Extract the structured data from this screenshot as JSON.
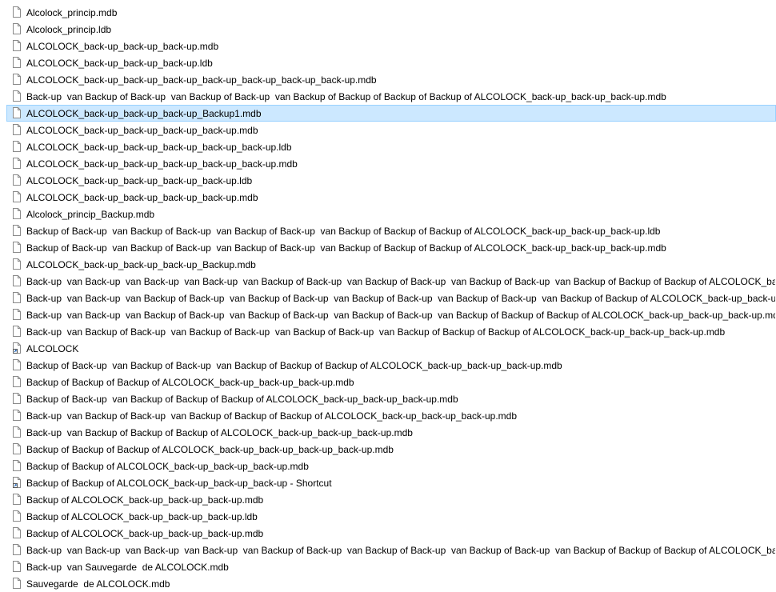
{
  "colors": {
    "selection_bg": "#cce8ff",
    "selection_border": "#99d1ff",
    "icon_stroke": "#8a8a8a",
    "text": "#000000"
  },
  "files": [
    {
      "name": "Alcolock_princip.mdb",
      "icon": "document-icon",
      "selected": false
    },
    {
      "name": "Alcolock_princip.ldb",
      "icon": "document-icon",
      "selected": false
    },
    {
      "name": "ALCOLOCK_back-up_back-up_back-up.mdb",
      "icon": "document-icon",
      "selected": false
    },
    {
      "name": "ALCOLOCK_back-up_back-up_back-up.ldb",
      "icon": "document-icon",
      "selected": false
    },
    {
      "name": "ALCOLOCK_back-up_back-up_back-up_back-up_back-up_back-up_back-up.mdb",
      "icon": "document-icon",
      "selected": false
    },
    {
      "name": "Back-up  van Backup of Back-up  van Backup of Back-up  van Backup of Backup of Backup of Backup of ALCOLOCK_back-up_back-up_back-up.mdb",
      "icon": "document-icon",
      "selected": false
    },
    {
      "name": "ALCOLOCK_back-up_back-up_back-up_Backup1.mdb",
      "icon": "document-icon",
      "selected": true
    },
    {
      "name": "ALCOLOCK_back-up_back-up_back-up_back-up.mdb",
      "icon": "document-icon",
      "selected": false
    },
    {
      "name": "ALCOLOCK_back-up_back-up_back-up_back-up_back-up.ldb",
      "icon": "document-icon",
      "selected": false
    },
    {
      "name": "ALCOLOCK_back-up_back-up_back-up_back-up_back-up.mdb",
      "icon": "document-icon",
      "selected": false
    },
    {
      "name": "ALCOLOCK_back-up_back-up_back-up_back-up.ldb",
      "icon": "document-icon",
      "selected": false
    },
    {
      "name": "ALCOLOCK_back-up_back-up_back-up_back-up.mdb",
      "icon": "document-icon",
      "selected": false
    },
    {
      "name": "Alcolock_princip_Backup.mdb",
      "icon": "document-icon",
      "selected": false
    },
    {
      "name": "Backup of Back-up  van Backup of Back-up  van Backup of Back-up  van Backup of Backup of Backup of ALCOLOCK_back-up_back-up_back-up.ldb",
      "icon": "document-icon",
      "selected": false
    },
    {
      "name": "Backup of Back-up  van Backup of Back-up  van Backup of Back-up  van Backup of Backup of Backup of ALCOLOCK_back-up_back-up_back-up.mdb",
      "icon": "document-icon",
      "selected": false
    },
    {
      "name": "ALCOLOCK_back-up_back-up_back-up_Backup.mdb",
      "icon": "document-icon",
      "selected": false
    },
    {
      "name": "Back-up  van Back-up  van Back-up  van Back-up  van Backup of Back-up  van Backup of Back-up  van Backup of Back-up  van Backup of Backup of Backup of ALCOLOCK_back-up_back-up_back-up.mdb",
      "icon": "document-icon",
      "selected": false
    },
    {
      "name": "Back-up  van Back-up  van Backup of Back-up  van Backup of Back-up  van Backup of Back-up  van Backup of Back-up  van Backup of Backup of ALCOLOCK_back-up_back-up_back-up.mdb",
      "icon": "document-icon",
      "selected": false
    },
    {
      "name": "Back-up  van Back-up  van Backup of Back-up  van Backup of Back-up  van Backup of Back-up  van Backup of Backup of Backup of ALCOLOCK_back-up_back-up_back-up.mdb",
      "icon": "document-icon",
      "selected": false
    },
    {
      "name": "Back-up  van Backup of Back-up  van Backup of Back-up  van Backup of Back-up  van Backup of Backup of Backup of ALCOLOCK_back-up_back-up_back-up.mdb",
      "icon": "document-icon",
      "selected": false
    },
    {
      "name": "ALCOLOCK",
      "icon": "shortcut-icon",
      "selected": false
    },
    {
      "name": "Backup of Back-up  van Backup of Back-up  van Backup of Backup of Backup of ALCOLOCK_back-up_back-up_back-up.mdb",
      "icon": "document-icon",
      "selected": false
    },
    {
      "name": "Backup of Backup of Backup of ALCOLOCK_back-up_back-up_back-up.mdb",
      "icon": "document-icon",
      "selected": false
    },
    {
      "name": "Backup of Back-up  van Backup of Backup of Backup of ALCOLOCK_back-up_back-up_back-up.mdb",
      "icon": "document-icon",
      "selected": false
    },
    {
      "name": "Back-up  van Backup of Back-up  van Backup of Backup of Backup of ALCOLOCK_back-up_back-up_back-up.mdb",
      "icon": "document-icon",
      "selected": false
    },
    {
      "name": "Back-up  van Backup of Backup of Backup of ALCOLOCK_back-up_back-up_back-up.mdb",
      "icon": "document-icon",
      "selected": false
    },
    {
      "name": "Backup of Backup of Backup of ALCOLOCK_back-up_back-up_back-up_back-up.mdb",
      "icon": "document-icon",
      "selected": false
    },
    {
      "name": "Backup of Backup of ALCOLOCK_back-up_back-up_back-up.mdb",
      "icon": "document-icon",
      "selected": false
    },
    {
      "name": "Backup of Backup of ALCOLOCK_back-up_back-up_back-up - Shortcut",
      "icon": "shortcut-icon",
      "selected": false
    },
    {
      "name": "Backup of ALCOLOCK_back-up_back-up_back-up.mdb",
      "icon": "document-icon",
      "selected": false
    },
    {
      "name": "Backup of ALCOLOCK_back-up_back-up_back-up.ldb",
      "icon": "document-icon",
      "selected": false
    },
    {
      "name": "Backup of ALCOLOCK_back-up_back-up_back-up.mdb",
      "icon": "document-icon",
      "selected": false
    },
    {
      "name": "Back-up  van Back-up  van Back-up  van Back-up  van Backup of Back-up  van Backup of Back-up  van Backup of Back-up  van Backup of Backup of Backup of ALCOLOCK_back-up_back-up_back-up.mdb",
      "icon": "document-icon",
      "selected": false
    },
    {
      "name": "Back-up  van Sauvegarde  de ALCOLOCK.mdb",
      "icon": "document-icon",
      "selected": false
    },
    {
      "name": "Sauvegarde  de ALCOLOCK.mdb",
      "icon": "document-icon",
      "selected": false
    }
  ]
}
